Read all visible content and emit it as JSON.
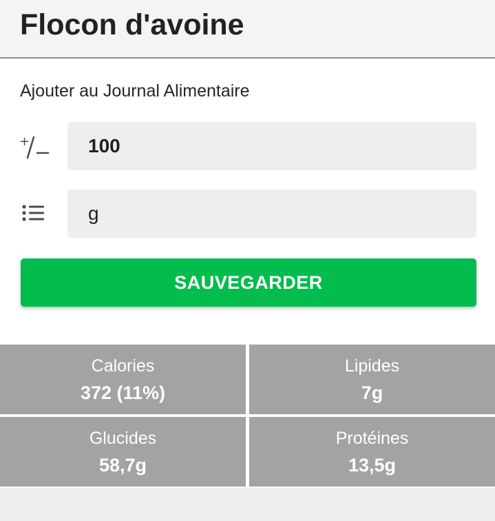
{
  "header": {
    "title": "Flocon d'avoine"
  },
  "form": {
    "section_title": "Ajouter au Journal Alimentaire",
    "quantity": {
      "icon": "plus-minus-icon",
      "value": "100"
    },
    "unit": {
      "icon": "list-icon",
      "value": "g"
    },
    "save_label": "SAUVEGARDER",
    "save_color": "#02bd4d"
  },
  "nutrition": {
    "calories": {
      "label": "Calories",
      "value": "372 (11%)"
    },
    "lipides": {
      "label": "Lipides",
      "value": "7g"
    },
    "glucides": {
      "label": "Glucides",
      "value": "58,7g"
    },
    "proteines": {
      "label": "Protéines",
      "value": "13,5g"
    },
    "tile_color": "#a3a3a3"
  }
}
